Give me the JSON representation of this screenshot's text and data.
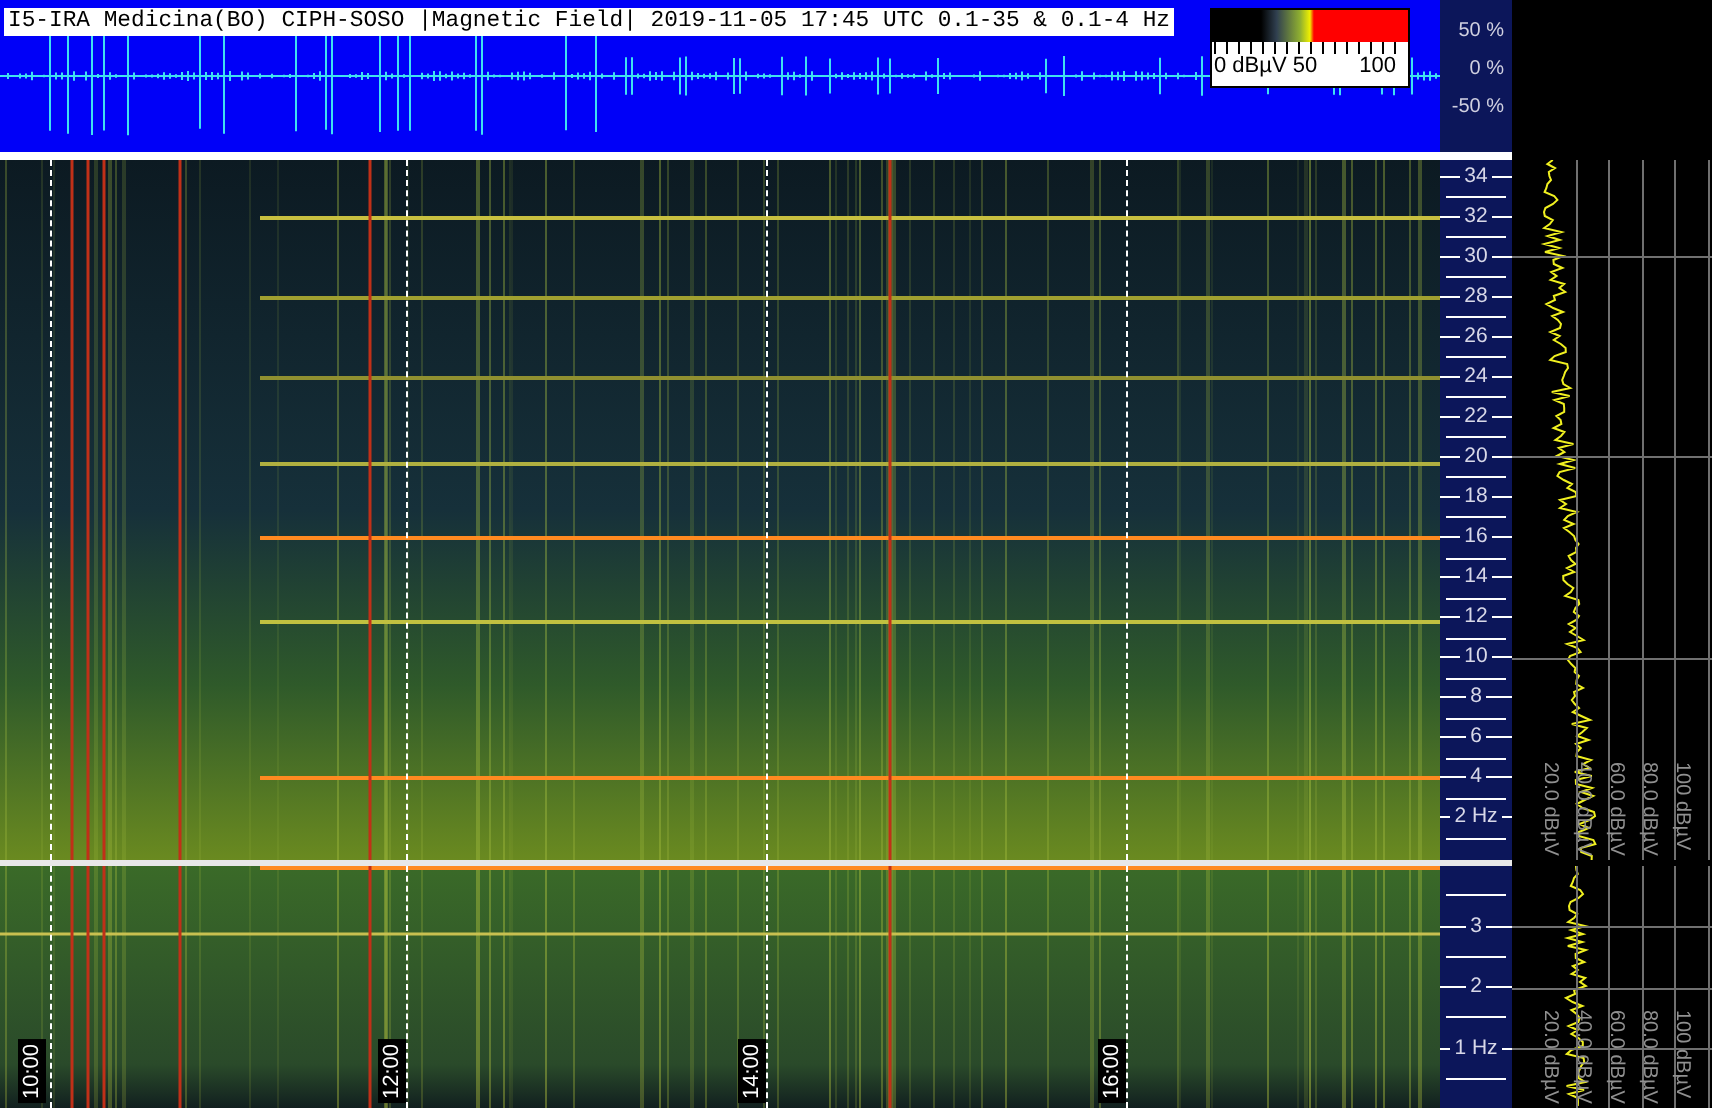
{
  "header": {
    "title": "I5-IRA Medicina(BO) CIPH-SOSO |Magnetic Field| 2019-11-05 17:45 UTC 0.1-35 & 0.1-4 Hz"
  },
  "colorbar": {
    "labels": [
      "0 dBµV 50",
      "100"
    ]
  },
  "waveform_axis": {
    "ticks": [
      "50 %",
      "0 %",
      "-50 %"
    ]
  },
  "upper_axis": {
    "ticks": [
      "34",
      "32",
      "30",
      "28",
      "26",
      "24",
      "22",
      "20",
      "18",
      "16",
      "14",
      "12",
      "10",
      "8",
      "6",
      "4",
      "2 Hz"
    ]
  },
  "upper_spectrum": {
    "scale_labels": [
      "20.0 dBµV",
      "40.0 dBµV",
      "60.0 dBµV",
      "80.0 dBµV",
      "100 dBµV"
    ]
  },
  "lower_axis": {
    "ticks": [
      "3",
      "2",
      "1 Hz"
    ]
  },
  "lower_spectrum": {
    "scale_labels": [
      "20.0 dBµV",
      "40.0 dBµV",
      "60.0 dBµV",
      "80.0 dBµV",
      "100 dBµV"
    ]
  },
  "time_labels": [
    "10:00",
    "12:00",
    "14:00",
    "16:00"
  ]
}
